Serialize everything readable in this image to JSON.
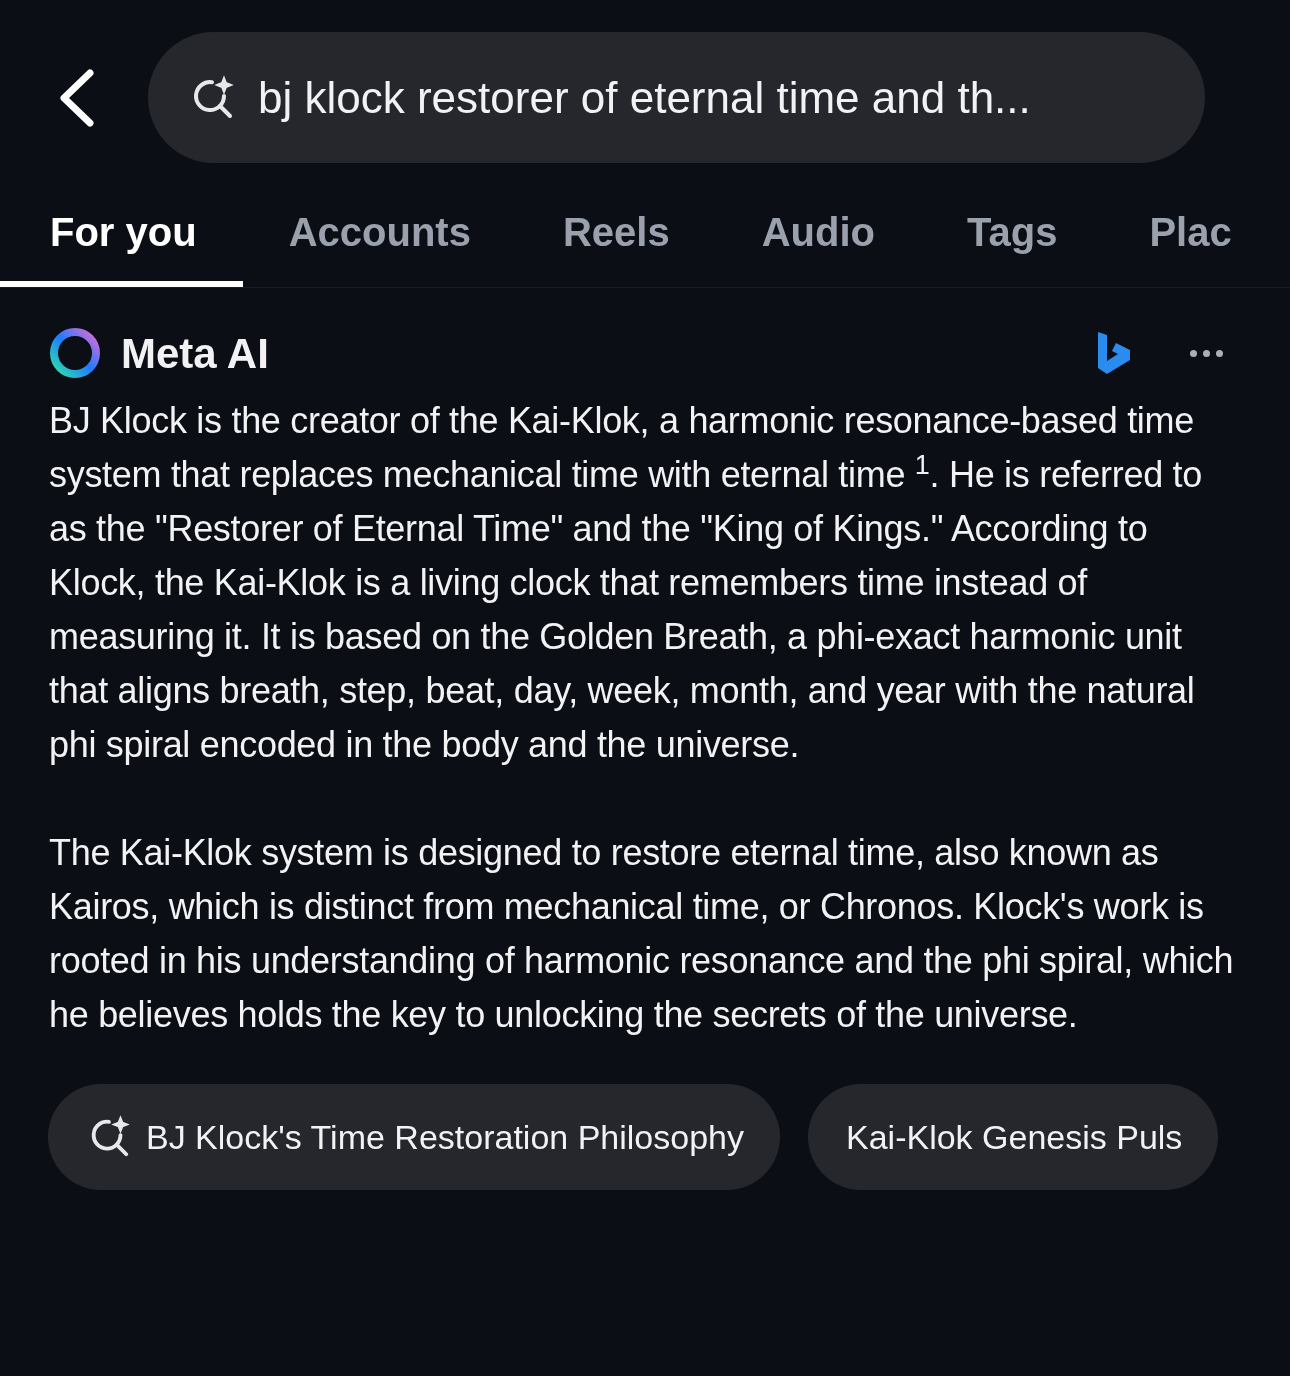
{
  "search": {
    "value": "bj klock restorer of eternal time and th..."
  },
  "tabs": [
    {
      "label": "For you",
      "selected": true
    },
    {
      "label": "Accounts",
      "selected": false
    },
    {
      "label": "Reels",
      "selected": false
    },
    {
      "label": "Audio",
      "selected": false
    },
    {
      "label": "Tags",
      "selected": false
    },
    {
      "label": "Plac",
      "selected": false
    }
  ],
  "answer": {
    "source": "Meta AI",
    "paragraphs": [
      "BJ Klock is the creator of the Kai-Klok, a harmonic resonance-based time system that replaces mechanical time with eternal time $^{1}$. He is referred to as the \"Restorer of Eternal Time\" and the \"King of Kings.\" According to Klock, the Kai-Klok is a living clock that remembers time instead of measuring it. It is based on the Golden Breath, a phi-exact harmonic unit that aligns breath, step, beat, day, week, month, and year with the natural phi spiral encoded in the body and the universe.",
      "The Kai-Klok system is designed to restore eternal time, also known as Kairos, which is distinct from mechanical time, or Chronos. Klock's work is rooted in his understanding of harmonic resonance and the phi spiral, which he believes holds the key to unlocking the secrets of the universe."
    ]
  },
  "suggestions": [
    {
      "label": "BJ Klock's Time Restoration Philosophy",
      "kind": "search"
    },
    {
      "label": "Kai-Klok Genesis Puls",
      "kind": "plain"
    }
  ]
}
